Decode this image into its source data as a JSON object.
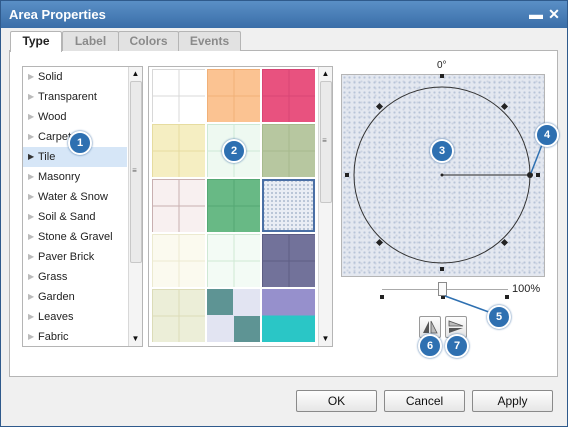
{
  "window": {
    "title": "Area Properties",
    "minimize_glyph": "▬",
    "close_glyph": "✕"
  },
  "tabs": [
    {
      "label": "Type",
      "active": true
    },
    {
      "label": "Label",
      "active": false
    },
    {
      "label": "Colors",
      "active": false
    },
    {
      "label": "Events",
      "active": false
    }
  ],
  "type_list": {
    "items": [
      "Solid",
      "Transparent",
      "Wood",
      "Carpet",
      "Tile",
      "Masonry",
      "Water & Snow",
      "Soil & Sand",
      "Stone & Gravel",
      "Paver Brick",
      "Grass",
      "Garden",
      "Leaves",
      "Fabric"
    ],
    "selected": "Tile"
  },
  "swatches": {
    "columns": 3,
    "selected_index": 8,
    "tiles": [
      {
        "pattern": "grid",
        "fg": "#d8d8d8",
        "bg": "#ffffff"
      },
      {
        "pattern": "grid",
        "fg": "#f0b078",
        "bg": "#fbc392"
      },
      {
        "pattern": "grid",
        "fg": "#d84575",
        "bg": "#e8527f"
      },
      {
        "pattern": "grid",
        "fg": "#e6dca0",
        "bg": "#f5eec2"
      },
      {
        "pattern": "grid",
        "fg": "#cde9d6",
        "bg": "#eef9f1"
      },
      {
        "pattern": "grid",
        "fg": "#a7ba8e",
        "bg": "#b7c7a0"
      },
      {
        "pattern": "grid",
        "fg": "#c9b0b0",
        "bg": "#f8f0f0"
      },
      {
        "pattern": "grid",
        "fg": "#54a873",
        "bg": "#68b985"
      },
      {
        "pattern": "dots",
        "fg": "#b6c3d5",
        "bg": "#e9edf4"
      },
      {
        "pattern": "grid",
        "fg": "#ecead0",
        "bg": "#fbfaef"
      },
      {
        "pattern": "grid",
        "fg": "#cfe8d4",
        "bg": "#f3fbf5"
      },
      {
        "pattern": "grid",
        "fg": "#5e5e84",
        "bg": "#72729a"
      },
      {
        "pattern": "grid",
        "fg": "#dcdcb8",
        "bg": "#eceed8"
      },
      {
        "pattern": "checker",
        "fg": "#5e9494",
        "bg": "#e2e4f2"
      },
      {
        "pattern": "split",
        "fg": "#2ac6c6",
        "bg": "#9690cc"
      }
    ]
  },
  "rotation": {
    "angle_label": "0°",
    "angle_value": 90
  },
  "scale": {
    "label": "100%",
    "value": 100
  },
  "icons": {
    "flip_horizontal": "flip-horizontal-icon",
    "flip_vertical": "flip-vertical-icon"
  },
  "callouts": [
    "1",
    "2",
    "3",
    "4",
    "5",
    "6",
    "7"
  ],
  "buttons": {
    "ok": "OK",
    "cancel": "Cancel",
    "apply": "Apply"
  },
  "colors": {
    "titlebar": "#4a7fba",
    "selection": "#d6e6f7",
    "callout": "#2e70b1",
    "accent": "#4a6fa5"
  }
}
